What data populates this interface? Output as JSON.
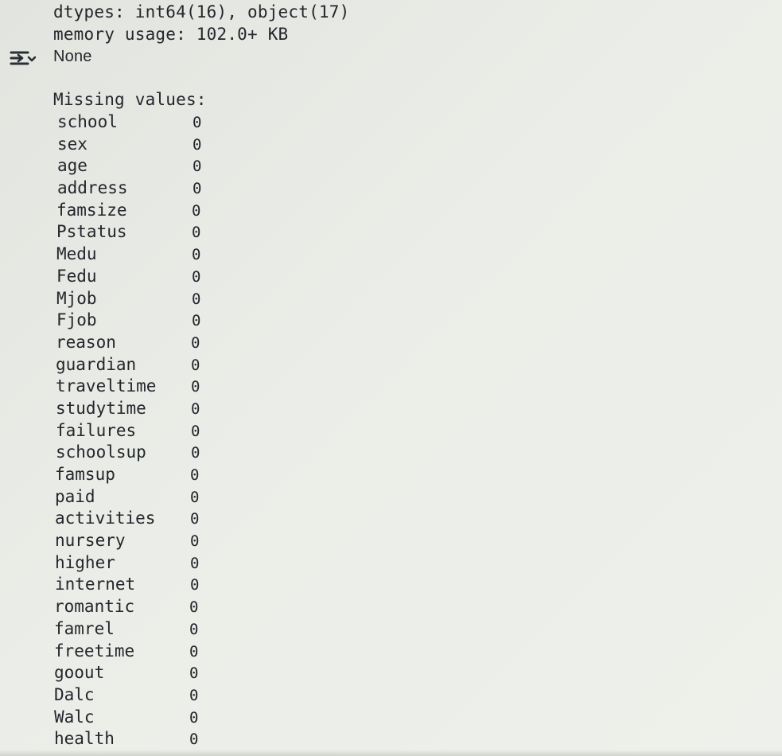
{
  "output": {
    "dtypes_line": "dtypes: int64(16), object(17)",
    "memory_line": "memory usage: 102.0+ KB",
    "print_result": "None",
    "missing_header": "Missing values:",
    "missing_values": [
      {
        "column": "school",
        "count": "0"
      },
      {
        "column": "sex",
        "count": "0"
      },
      {
        "column": "age",
        "count": "0"
      },
      {
        "column": "address",
        "count": "0"
      },
      {
        "column": "famsize",
        "count": "0"
      },
      {
        "column": "Pstatus",
        "count": "0"
      },
      {
        "column": "Medu",
        "count": "0"
      },
      {
        "column": "Fedu",
        "count": "0"
      },
      {
        "column": "Mjob",
        "count": "0"
      },
      {
        "column": "Fjob",
        "count": "0"
      },
      {
        "column": "reason",
        "count": "0"
      },
      {
        "column": "guardian",
        "count": "0"
      },
      {
        "column": "traveltime",
        "count": "0"
      },
      {
        "column": "studytime",
        "count": "0"
      },
      {
        "column": "failures",
        "count": "0"
      },
      {
        "column": "schoolsup",
        "count": "0"
      },
      {
        "column": "famsup",
        "count": "0"
      },
      {
        "column": "paid",
        "count": "0"
      },
      {
        "column": "activities",
        "count": "0"
      },
      {
        "column": "nursery",
        "count": "0"
      },
      {
        "column": "higher",
        "count": "0"
      },
      {
        "column": "internet",
        "count": "0"
      },
      {
        "column": "romantic",
        "count": "0"
      },
      {
        "column": "famrel",
        "count": "0"
      },
      {
        "column": "freetime",
        "count": "0"
      },
      {
        "column": "goout",
        "count": "0"
      },
      {
        "column": "Dalc",
        "count": "0"
      },
      {
        "column": "Walc",
        "count": "0"
      },
      {
        "column": "health",
        "count": "0"
      }
    ]
  },
  "icons": {
    "output_toggle": "output-toggle-icon"
  },
  "colors": {
    "text": "#23262b",
    "background": "#ebede8"
  }
}
